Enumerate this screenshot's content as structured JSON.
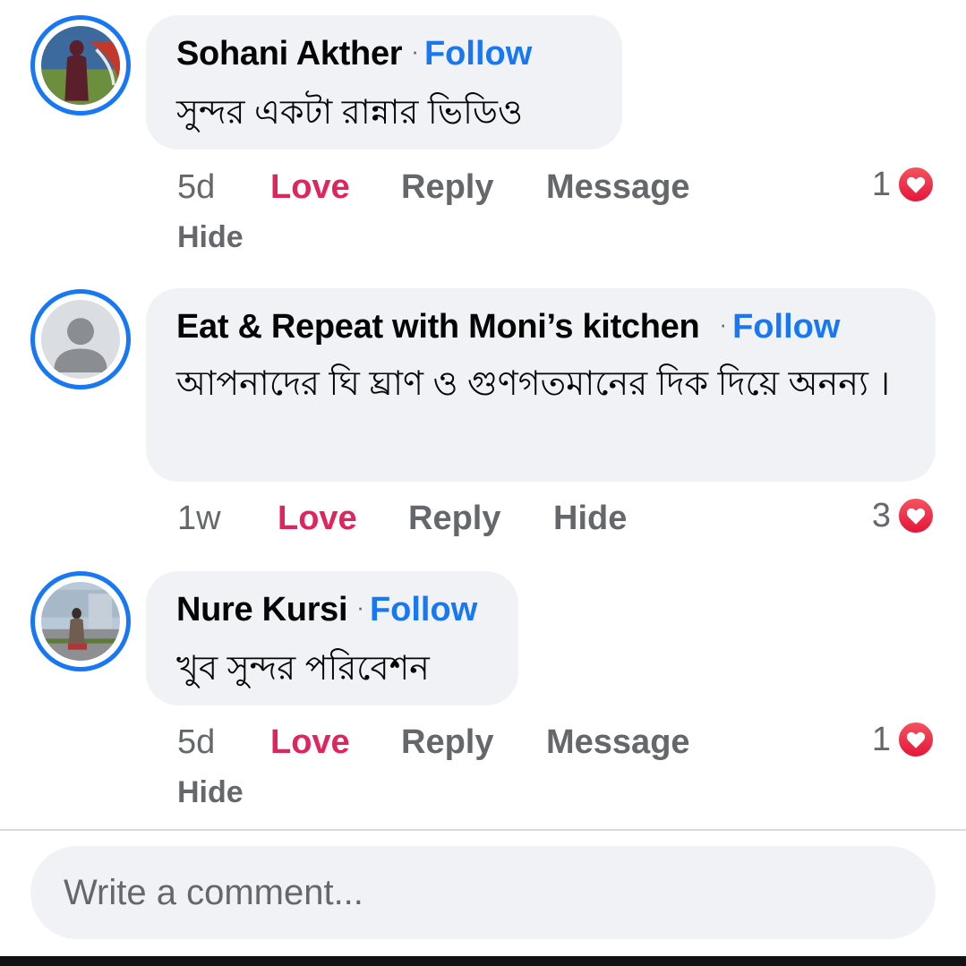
{
  "comments": [
    {
      "author": "Sohani Akther",
      "follow_label": "Follow",
      "text": "সুন্দর একটা রান্নার ভিডিও",
      "time": "5d",
      "love_label": "Love",
      "reply_label": "Reply",
      "message_label": "Message",
      "hide_label": "Hide",
      "reaction_count": "1",
      "reaction_icon": "heart-icon"
    },
    {
      "author": "Eat & Repeat with Moni’s kitchen",
      "follow_label": "Follow",
      "text": "আপনাদের ঘি ঘ্রাণ ও গুণগতমানের দিক দিয়ে অনন্য ।",
      "time": "1w",
      "love_label": "Love",
      "reply_label": "Reply",
      "hide_label": "Hide",
      "reaction_count": "3",
      "reaction_icon": "heart-icon"
    },
    {
      "author": "Nure Kursi",
      "follow_label": "Follow",
      "text": "খুব সুন্দর পরিবেশন",
      "time": "5d",
      "love_label": "Love",
      "reply_label": "Reply",
      "message_label": "Message",
      "hide_label": "Hide",
      "reaction_count": "1",
      "reaction_icon": "heart-icon"
    }
  ],
  "composer": {
    "placeholder": "Write a comment..."
  },
  "colors": {
    "accent": "#1877f2",
    "love": "#e0245e",
    "bubble": "#f0f2f5",
    "muted_text": "#65676b"
  }
}
